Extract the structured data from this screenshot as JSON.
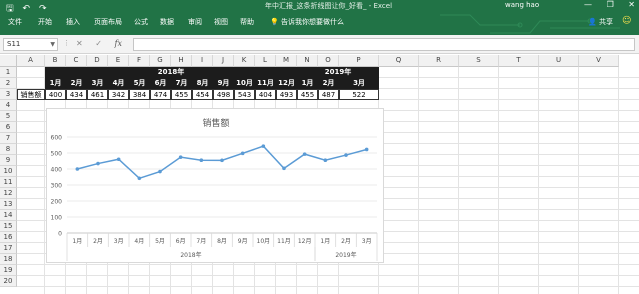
{
  "window": {
    "title": "年中汇报_这条折线图让你_好看_  -  Excel",
    "user": "wang hao",
    "controls": [
      "—",
      "❐",
      "✕"
    ]
  },
  "quick_access": {
    "save": "🖫",
    "undo": "↶",
    "redo": "↷"
  },
  "ribbon": {
    "tabs": [
      "文件",
      "开始",
      "插入",
      "页面布局",
      "公式",
      "数据",
      "审阅",
      "视图",
      "帮助"
    ],
    "tell_me": "告诉我你想要做什么",
    "share": "共享",
    "feedback": "☺"
  },
  "formula_bar": {
    "name_box": "S11",
    "cancel": "✕",
    "enter": "✓",
    "fx": "fx",
    "value": ""
  },
  "columns": [
    "A",
    "B",
    "C",
    "D",
    "E",
    "F",
    "G",
    "H",
    "I",
    "J",
    "K",
    "L",
    "M",
    "N",
    "O",
    "P",
    "Q",
    "R",
    "S",
    "T",
    "U",
    "V"
  ],
  "rows": [
    "1",
    "2",
    "3",
    "4",
    "5",
    "6",
    "7",
    "8",
    "9",
    "10",
    "11",
    "12",
    "13",
    "14",
    "15",
    "16",
    "17",
    "18",
    "19",
    "20"
  ],
  "sheet": {
    "year_2018": "2018年",
    "year_2019": "2019年",
    "months": [
      "1月",
      "2月",
      "3月",
      "4月",
      "5月",
      "6月",
      "7月",
      "8月",
      "9月",
      "10月",
      "11月",
      "12月",
      "1月",
      "2月",
      "3月"
    ],
    "row_label": "销售额",
    "values": [
      "400",
      "434",
      "461",
      "342",
      "384",
      "474",
      "455",
      "454",
      "498",
      "543",
      "404",
      "493",
      "455",
      "487",
      "522"
    ]
  },
  "chart_data": {
    "type": "line",
    "title": "销售额",
    "categories": [
      "1月",
      "2月",
      "3月",
      "4月",
      "5月",
      "6月",
      "7月",
      "8月",
      "9月",
      "10月",
      "11月",
      "12月",
      "1月",
      "2月",
      "3月"
    ],
    "groups": [
      {
        "label": "2018年",
        "count": 12
      },
      {
        "label": "2019年",
        "count": 3
      }
    ],
    "series": [
      {
        "values": [
          400,
          434,
          461,
          342,
          384,
          474,
          455,
          454,
          498,
          543,
          404,
          493,
          455,
          487,
          522
        ]
      }
    ],
    "ylim": [
      0,
      600
    ],
    "yticks": [
      "0",
      "100",
      "200",
      "300",
      "400",
      "500",
      "600"
    ],
    "grid": true,
    "color": "#5b9bd5"
  }
}
